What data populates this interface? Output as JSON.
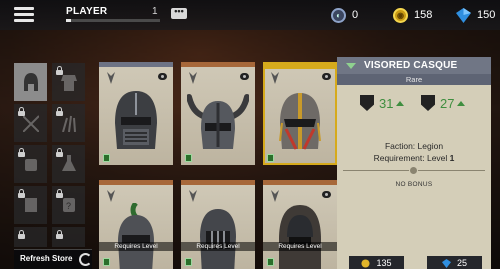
{
  "header": {
    "menu_icon": "hamburger-icon",
    "player_label": "PLAYER",
    "player_level": "1",
    "xp_progress": 0.05,
    "chat_label": "•••",
    "currencies": [
      {
        "icon": "steel-icon",
        "value": "0"
      },
      {
        "icon": "coin-icon",
        "value": "158"
      },
      {
        "icon": "gem-icon",
        "value": "150"
      }
    ]
  },
  "categories": [
    {
      "icon": "helmet-icon",
      "locked": false,
      "active": true
    },
    {
      "icon": "armor-icon",
      "locked": true
    },
    {
      "icon": "arms-icon",
      "locked": true
    },
    {
      "icon": "weapon-icon",
      "locked": true
    },
    {
      "icon": "gauntlet-icon",
      "locked": true
    },
    {
      "icon": "pommel-icon",
      "locked": true
    },
    {
      "icon": "banner-icon",
      "locked": true
    },
    {
      "icon": "potion-icon",
      "locked": true
    },
    {
      "icon": "effects-icon",
      "locked": true
    },
    {
      "icon": "emote-icon",
      "locked": true
    }
  ],
  "items": [
    {
      "name": "knight-great-helm",
      "rarity_color": "#6d7385",
      "requirement": ""
    },
    {
      "name": "horned-helm",
      "rarity_color": "#a7683a",
      "requirement": ""
    },
    {
      "name": "visored-casque",
      "rarity_color": "#d6aa1c",
      "requirement": "",
      "selected": true
    },
    {
      "name": "plumed-helm",
      "rarity_color": "#a7683a",
      "requirement": "Requires Level"
    },
    {
      "name": "barred-helm",
      "rarity_color": "#a7683a",
      "requirement": "Requires Level"
    },
    {
      "name": "hooded-helm",
      "rarity_color": "#a7683a",
      "requirement": "Requires Level"
    }
  ],
  "detail": {
    "title": "VISORED CASQUE",
    "rarity": "Rare",
    "stat_left": "31",
    "stat_right": "27",
    "faction_line": "Faction: Legion",
    "requirement_label": "Requirement: Level ",
    "requirement_level": "1",
    "bonus": "NO BONUS",
    "price_coins": "135",
    "price_gems": "25"
  },
  "footer": {
    "refresh_label": "Refresh Store"
  },
  "colors": {
    "gold": "#d6aa1c",
    "green": "#3f8e3f",
    "panel": "#d4ceb8"
  }
}
